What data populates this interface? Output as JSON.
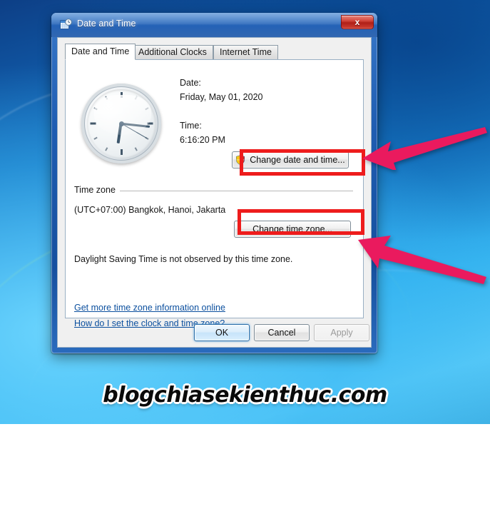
{
  "window": {
    "title": "Date and Time",
    "icon": "date-time-calendar-clock-icon",
    "close_label": "x"
  },
  "tabs": [
    {
      "label": "Date and Time",
      "active": true
    },
    {
      "label": "Additional Clocks",
      "active": false
    },
    {
      "label": "Internet Time",
      "active": false
    }
  ],
  "date_time_panel": {
    "date_label": "Date:",
    "date_value": "Friday, May 01, 2020",
    "time_label": "Time:",
    "time_value": "6:16:20 PM",
    "change_datetime_button": "Change date and time...",
    "change_datetime_icon": "uac-shield-icon",
    "clock": {
      "name": "analog-clock",
      "hour_angle": 188,
      "minute_angle": 96,
      "second_angle": 120
    }
  },
  "time_zone": {
    "group_label": "Time zone",
    "value": "(UTC+07:00) Bangkok, Hanoi, Jakarta",
    "change_button": "Change time zone...",
    "dst_note": "Daylight Saving Time is not observed by this time zone."
  },
  "links": [
    {
      "label": "Get more time zone information online"
    },
    {
      "label": "How do I set the clock and time zone?"
    }
  ],
  "buttons": {
    "ok": "OK",
    "cancel": "Cancel",
    "apply": "Apply"
  },
  "annotations": {
    "highlight_color": "#ee1c1c",
    "arrow_color": "#ea1a5e",
    "arrow_top_name": "arrow-pointing-to-change-date-and-time",
    "arrow_bottom_name": "arrow-pointing-to-daylight-saving-note"
  },
  "watermark": {
    "text": "blogchiasekienthuc.com"
  }
}
